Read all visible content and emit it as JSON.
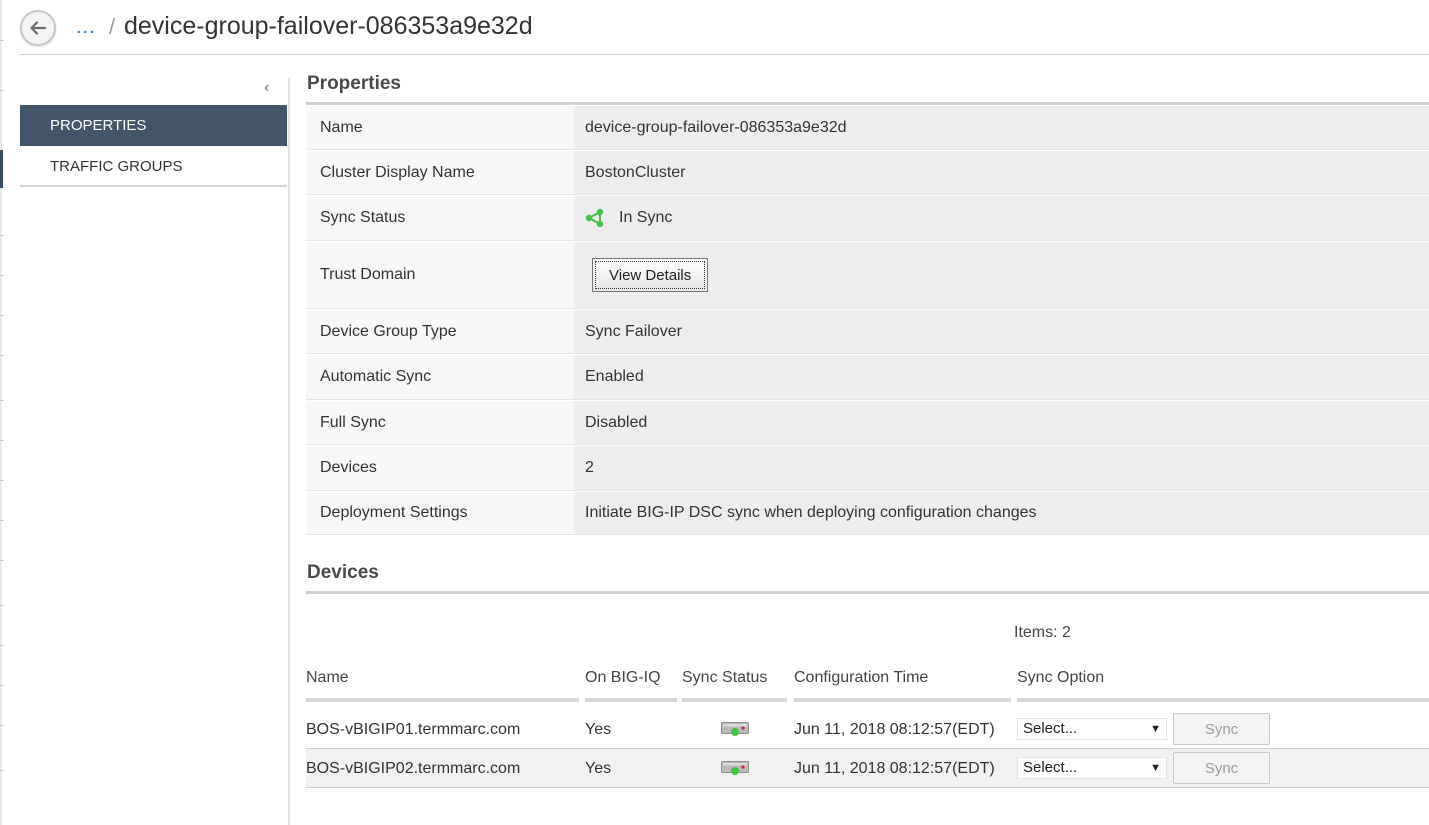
{
  "header": {
    "breadcrumb_ellipsis": "...",
    "breadcrumb_separator": "/",
    "title": "device-group-failover-086353a9e32d"
  },
  "sidebar": {
    "collapse_glyph": "‹",
    "items": [
      {
        "label": "PROPERTIES",
        "active": true
      },
      {
        "label": "TRAFFIC GROUPS",
        "active": false
      }
    ]
  },
  "properties": {
    "title": "Properties",
    "rows": [
      {
        "label": "Name",
        "value": "device-group-failover-086353a9e32d"
      },
      {
        "label": "Cluster Display Name",
        "value": "BostonCluster"
      },
      {
        "label": "Sync Status",
        "value": "In Sync",
        "icon": "in-sync-icon"
      },
      {
        "label": "Trust Domain",
        "button": "View Details"
      },
      {
        "label": "Device Group Type",
        "value": "Sync Failover"
      },
      {
        "label": "Automatic Sync",
        "value": "Enabled"
      },
      {
        "label": "Full Sync",
        "value": "Disabled"
      },
      {
        "label": "Devices",
        "value": "2"
      },
      {
        "label": "Deployment Settings",
        "value": "Initiate BIG-IP DSC sync when deploying configuration changes"
      }
    ]
  },
  "devices": {
    "title": "Devices",
    "items_count": "Items: 2",
    "columns": [
      "Name",
      "On BIG-IQ",
      "Sync Status",
      "Configuration Time",
      "Sync Option"
    ],
    "rows": [
      {
        "name": "BOS-vBIGIP01.termmarc.com",
        "on_bigiq": "Yes",
        "status_icon": "device-status-icon",
        "config_time": "Jun 11, 2018 08:12:57(EDT)",
        "sync_option": "Select...",
        "sync_button": "Sync"
      },
      {
        "name": "BOS-vBIGIP02.termmarc.com",
        "on_bigiq": "Yes",
        "status_icon": "device-status-icon",
        "config_time": "Jun 11, 2018 08:12:57(EDT)",
        "sync_option": "Select...",
        "sync_button": "Sync"
      }
    ]
  },
  "colors": {
    "sidebar_active_bg": "#435669",
    "link_blue": "#1a73b8",
    "status_green": "#4bbf4b",
    "status_red": "#d9262e"
  }
}
